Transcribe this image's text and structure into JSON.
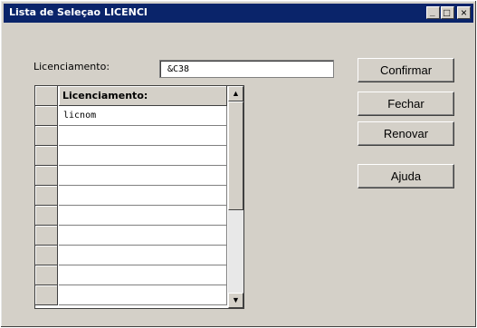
{
  "window": {
    "title": "Lista de Seleçao LICENCI",
    "minimize_glyph": "_",
    "maximize_glyph": "□",
    "close_glyph": "×"
  },
  "form": {
    "field_label": "Licenciamento:",
    "field_value": "&C38"
  },
  "grid": {
    "header": "Licenciamento:",
    "rows": [
      "licnom",
      "",
      "",
      "",
      "",
      "",
      "",
      "",
      "",
      ""
    ],
    "scroll_up_glyph": "▲",
    "scroll_down_glyph": "▼"
  },
  "buttons": {
    "confirm": "Confirmar",
    "close": "Fechar",
    "renew": "Renovar",
    "help": "Ajuda"
  },
  "colors": {
    "titlebar": "#0a246a",
    "face": "#d4d0c8"
  }
}
